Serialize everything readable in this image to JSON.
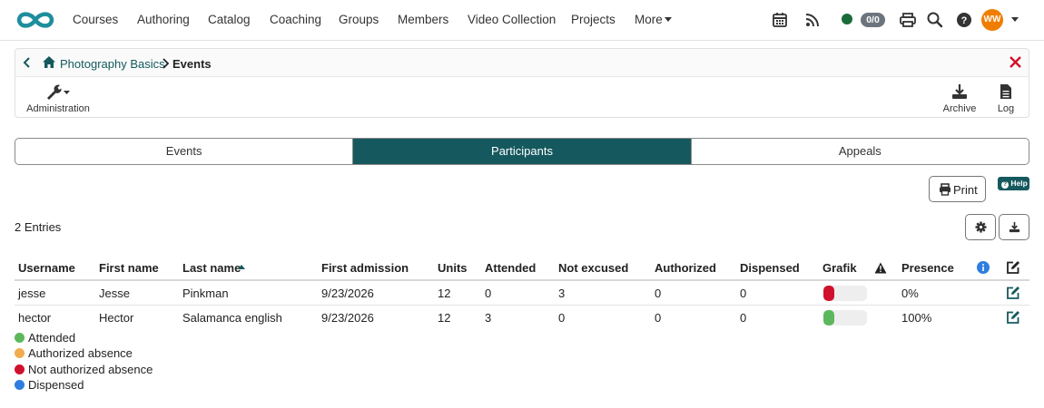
{
  "nav": {
    "items": [
      "Courses",
      "Authoring",
      "Catalog",
      "Coaching",
      "Groups",
      "Members",
      "Video Collection",
      "Projects",
      "More"
    ],
    "counter": "0/0",
    "avatar_initials": "WW"
  },
  "breadcrumb": {
    "course": "Photography Basics",
    "current": "Events"
  },
  "toolbar": {
    "administration": "Administration",
    "archive": "Archive",
    "log": "Log"
  },
  "tabs": [
    "Events",
    "Participants",
    "Appeals"
  ],
  "active_tab": "Participants",
  "actions": {
    "print": "Print",
    "help": "Help"
  },
  "entries_text": "2 Entries",
  "table": {
    "columns": [
      "Username",
      "First name",
      "Last name",
      "First admission",
      "Units",
      "Attended",
      "Not excused",
      "Authorized",
      "Dispensed",
      "Grafik",
      "Presence"
    ],
    "rows": [
      {
        "username": "jesse",
        "first_name": "Jesse",
        "last_name": "Pinkman",
        "first_admission": "9/23/2026",
        "units": "12",
        "attended": "0",
        "not_excused": "3",
        "authorized": "0",
        "dispensed": "0",
        "bar_fraction": 0.25,
        "bar_color": "#d0112b",
        "presence": "0%"
      },
      {
        "username": "hector",
        "first_name": "Hector",
        "last_name": "Salamanca english",
        "first_admission": "9/23/2026",
        "units": "12",
        "attended": "3",
        "not_excused": "0",
        "authorized": "0",
        "dispensed": "0",
        "bar_fraction": 0.25,
        "bar_color": "#5cb85c",
        "presence": "100%"
      }
    ]
  },
  "legend": [
    {
      "label": "Attended",
      "color": "#5cb85c"
    },
    {
      "label": "Authorized absence",
      "color": "#f0ad4e"
    },
    {
      "label": "Not authorized absence",
      "color": "#d0112b"
    },
    {
      "label": "Dispensed",
      "color": "#2f7de1"
    }
  ],
  "colors": {
    "brand": "#15595e",
    "link": "#15595e",
    "accent": "#f07d00"
  }
}
